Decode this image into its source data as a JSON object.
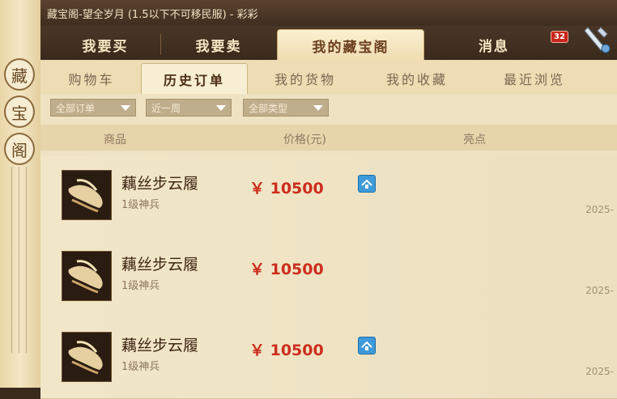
{
  "window": {
    "title": "藏宝阁-望全岁月 (1.5以下不可移民服) - 彩彩"
  },
  "sidebar": {
    "title_chars": [
      "藏",
      "宝",
      "阁"
    ]
  },
  "top_tabs": [
    {
      "label": "我要买",
      "active": false
    },
    {
      "label": "我要卖",
      "active": false
    },
    {
      "label": "我的藏宝阁",
      "active": true
    },
    {
      "label": "消息",
      "active": false
    }
  ],
  "message_badge": "32",
  "sub_tabs": [
    {
      "label": "购物车",
      "active": false
    },
    {
      "label": "历史订单",
      "active": true
    },
    {
      "label": "我的货物",
      "active": false
    },
    {
      "label": "我的收藏",
      "active": false
    },
    {
      "label": "最近浏览",
      "active": false
    }
  ],
  "filters": {
    "order": "全部订单",
    "time": "近一周",
    "type": "全部类型"
  },
  "table_headers": {
    "item": "商品",
    "price": "价格(元)",
    "highlight": "亮点"
  },
  "orders": [
    {
      "name": "藕丝步云履",
      "level": "1级神兵",
      "price": "￥ 10500",
      "has_info_icon": true,
      "date": "2025-"
    },
    {
      "name": "藕丝步云履",
      "level": "1级神兵",
      "price": "￥ 10500",
      "has_info_icon": false,
      "date": "2025-"
    },
    {
      "name": "藕丝步云履",
      "level": "1级神兵",
      "price": "￥ 10500",
      "has_info_icon": true,
      "date": "2025-"
    }
  ],
  "colors": {
    "price_red": "#cc2d1d",
    "badge_red": "#c9261c",
    "info_blue": "#3e9ad8"
  }
}
